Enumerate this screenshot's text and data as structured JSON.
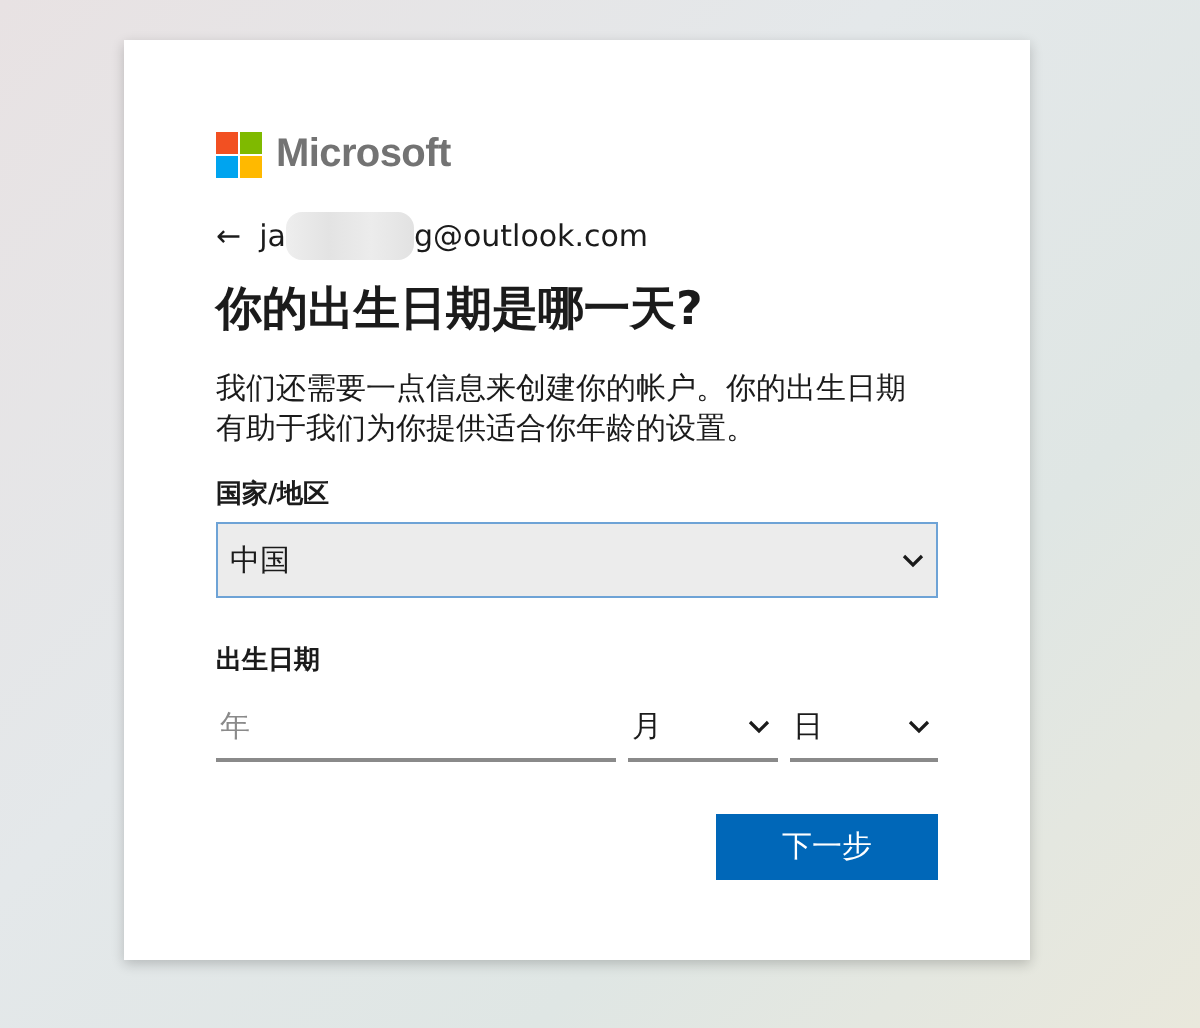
{
  "brand": {
    "name": "Microsoft"
  },
  "account": {
    "back": "←",
    "email_start": "ja",
    "email_end": "g@outlook.com"
  },
  "title": "你的出生日期是哪一天?",
  "description": "我们还需要一点信息来创建你的帐户。你的出生日期有助于我们为你提供适合你年龄的设置。",
  "country": {
    "label": "国家/地区",
    "value": "中国"
  },
  "birthdate": {
    "label": "出生日期",
    "year": {
      "placeholder": "年"
    },
    "month": {
      "value": "月"
    },
    "day": {
      "value": "日"
    }
  },
  "buttons": [
    {
      "label": "下一步"
    }
  ]
}
